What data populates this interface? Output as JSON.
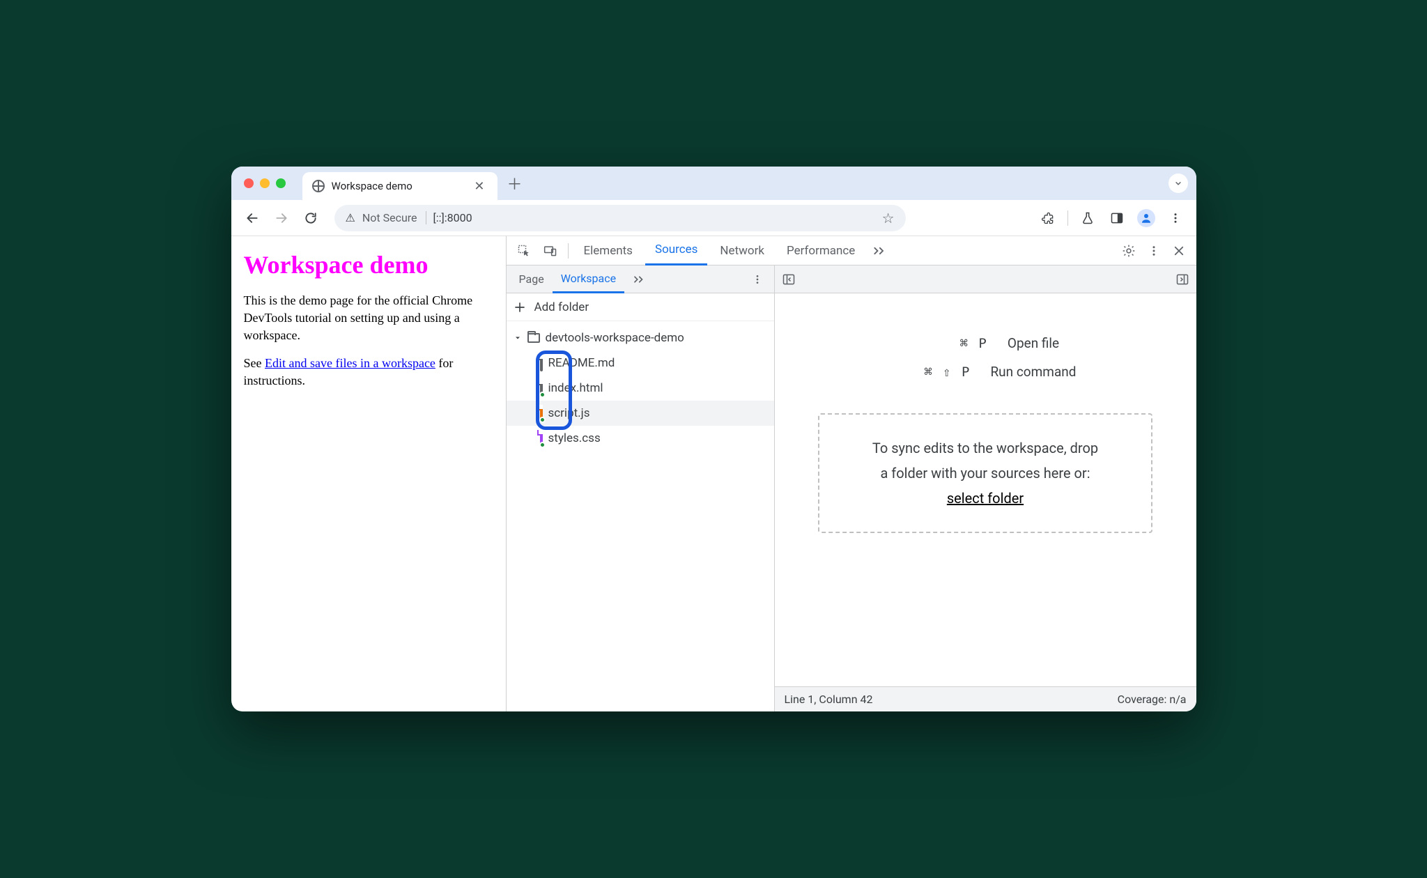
{
  "browser": {
    "tab_title": "Workspace demo",
    "security_label": "Not Secure",
    "url": "[::]:8000"
  },
  "page": {
    "heading": "Workspace demo",
    "p1": "This is the demo page for the official Chrome DevTools tutorial on setting up and using a workspace.",
    "p2_pre": "See ",
    "p2_link": "Edit and save files in a workspace",
    "p2_post": " for instructions."
  },
  "devtools": {
    "tabs": [
      "Elements",
      "Sources",
      "Network",
      "Performance"
    ],
    "active_tab": "Sources",
    "nav": {
      "tabs": [
        "Page",
        "Workspace"
      ],
      "active": "Workspace",
      "add_folder": "Add folder",
      "folder": "devtools-workspace-demo",
      "files": [
        {
          "name": "README.md",
          "color": "gray",
          "synced": false
        },
        {
          "name": "index.html",
          "color": "gray",
          "synced": true
        },
        {
          "name": "script.js",
          "color": "orange",
          "synced": true,
          "selected": true
        },
        {
          "name": "styles.css",
          "color": "purple",
          "synced": true
        }
      ]
    },
    "editor": {
      "shortcut1_keys": "⌘ P",
      "shortcut1_label": "Open file",
      "shortcut2_keys": "⌘ ⇧ P",
      "shortcut2_label": "Run command",
      "drop_line1": "To sync edits to the workspace, drop",
      "drop_line2": "a folder with your sources here or:",
      "drop_link": "select folder"
    },
    "status": {
      "cursor": "Line 1, Column 42",
      "coverage": "Coverage: n/a"
    }
  }
}
